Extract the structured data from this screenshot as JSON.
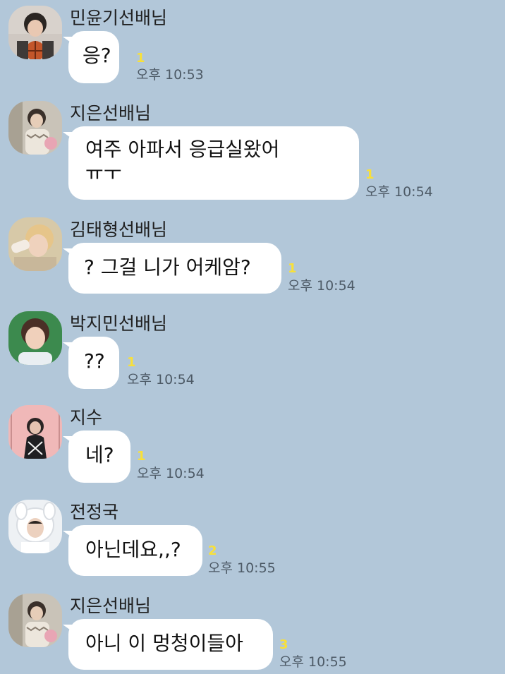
{
  "colors": {
    "background": "#b2c7d9",
    "bubble": "#ffffff",
    "unread": "#f8e03a",
    "time": "#4d5a66"
  },
  "messages": [
    {
      "sender": "민윤기선배님",
      "text": "응?",
      "unread": "1",
      "time": "오후 10:53",
      "avatar_icon": "profile-photo-icon"
    },
    {
      "sender": "지은선배님",
      "text": "여주 아파서 응급실왔어\nㅠㅜ",
      "unread": "1",
      "time": "오후 10:54",
      "avatar_icon": "profile-photo-icon"
    },
    {
      "sender": "김태형선배님",
      "text": "? 그걸 니가 어케암?",
      "unread": "1",
      "time": "오후 10:54",
      "avatar_icon": "profile-photo-icon"
    },
    {
      "sender": "박지민선배님",
      "text": "??",
      "unread": "1",
      "time": "오후 10:54",
      "avatar_icon": "profile-photo-icon"
    },
    {
      "sender": "지수",
      "text": "네?",
      "unread": "1",
      "time": "오후 10:54",
      "avatar_icon": "profile-photo-icon"
    },
    {
      "sender": "전정국",
      "text": "아닌데요,,?",
      "unread": "2",
      "time": "오후 10:55",
      "avatar_icon": "profile-photo-icon"
    },
    {
      "sender": "지은선배님",
      "text": "아니 이 멍청이들아",
      "unread": "3",
      "time": "오후 10:55",
      "avatar_icon": "profile-photo-icon"
    }
  ]
}
